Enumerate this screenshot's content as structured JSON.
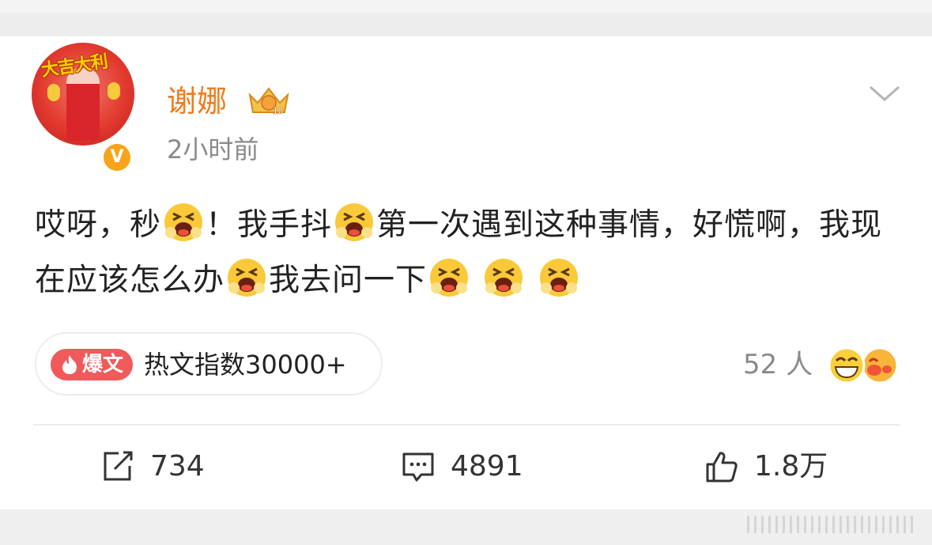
{
  "post": {
    "author": {
      "name": "谢娜",
      "avatar_banner": "大吉大利",
      "verified_badge": "V",
      "vip_level": "10"
    },
    "timestamp": "2小时前",
    "text_segments": [
      "哎呀，秒",
      "！我手抖",
      "第一次遇到这种事情，好慌啊，我现在应该怎么办",
      "我去问一下",
      "",
      "",
      ""
    ],
    "emoji_name": "crying-face-emoji",
    "hot": {
      "tag": "爆文",
      "label": "热文指数30000+"
    },
    "likers": {
      "count_label": "52 人",
      "emojis": [
        "laughing-face-emoji",
        "blush-face-emoji"
      ]
    },
    "actions": {
      "repost": "734",
      "comment": "4891",
      "like": "1.8万"
    }
  },
  "colors": {
    "username": "#f27a1a",
    "hot_tag": "#f05a5a",
    "meta_gray": "#8a8a8a",
    "text": "#222222",
    "background": "#ededed"
  }
}
